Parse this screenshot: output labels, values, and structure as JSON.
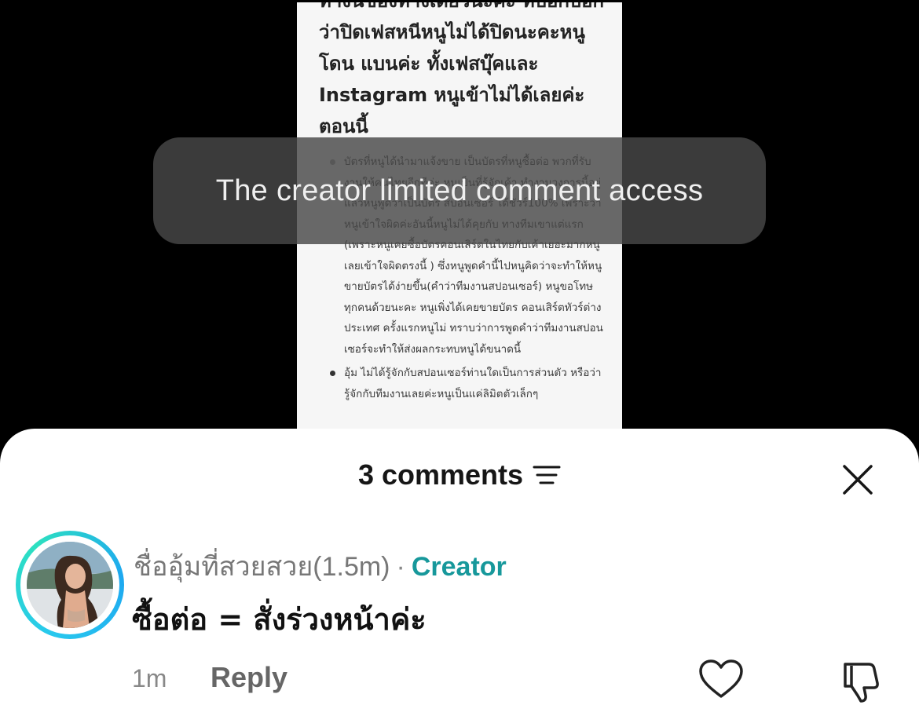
{
  "post": {
    "heading": "ทางนี้ของทางเดียวนะคะ ที่บอกบอกว่าปิดเฟสหนีหนูไม่ได้ปิดนะคะหนูโดน แบนค่ะ ทั้งเฟสบุ๊คและ Instagram หนูเข้าไม่ได้เลยค่ะ ตอนนี้",
    "bullet_1": "บัตรที่หนูได้นำมาแจ้งขาย เป็นบัตรที่หนูซื้อต่อ พวกที่รับงานให้คนไทยอีกทีค่ะ หนูเป็นที่รู้จักเค้า ทำงานวงการนี้อยู่ แล้วหนูพูดว่าเป็นบัตร สปอนเซอร์ ได้ชัวร์100% เพราะว่าหนูเข้าใจผิดค่ะอันนี้หนูไม่ได้คุยกับ ทางทีมเขาแต่แรก (เพราะหนูเคยซื้อบัตรคอนเสิร์ตในไทยกับเค้าเยอะมากหนูเลยเข้าใจผิดตรงนี้ ) ซึ่งหนูพูดคำนี้ไปหนูคิดว่าจะทำให้หนูขายบัตรได้ง่ายขึ้น(คำว่าทีมงานสปอนเซอร์) หนูขอโทษทุกคนด้วยนะคะ หนูเพิ่งได้เคยขายบัตร คอนเสิร์ตทัวร์ต่างประเทศ ครั้งแรกหนูไม่ ทราบว่าการพูดคำว่าทีมงานสปอนเซอร์จะทำให้ส่งผลกระทบหนูได้ขนาดนี้",
    "bullet_2": "อุ้ม ไม่ได้รู้จักกับสปอนเซอร์ท่านใดเป็นการส่วนตัว หรือว่ารู้จักกับทีมงานเลยค่ะหนูเป็นแค่ลิมิตตัวเล็กๆ"
  },
  "toast": {
    "text": "The creator limited comment access"
  },
  "sheet": {
    "title": "3 comments",
    "sort_icon": "sort-lines-icon",
    "close_icon": "close-x-icon"
  },
  "comment": {
    "author": "ชื่ออุ้มที่สวยสวย(1.5m)",
    "separator": "·",
    "badge": "Creator",
    "text": "ซื้อต่อ = สั่งร่วงหน้าค่ะ",
    "time": "1m",
    "reply_label": "Reply",
    "like_icon": "heart-outline-icon",
    "dislike_icon": "thumbs-down-icon"
  },
  "colors": {
    "creator_badge": "#17989b",
    "avatar_ring": "#28c8ee",
    "toast_bg": "#484848"
  }
}
